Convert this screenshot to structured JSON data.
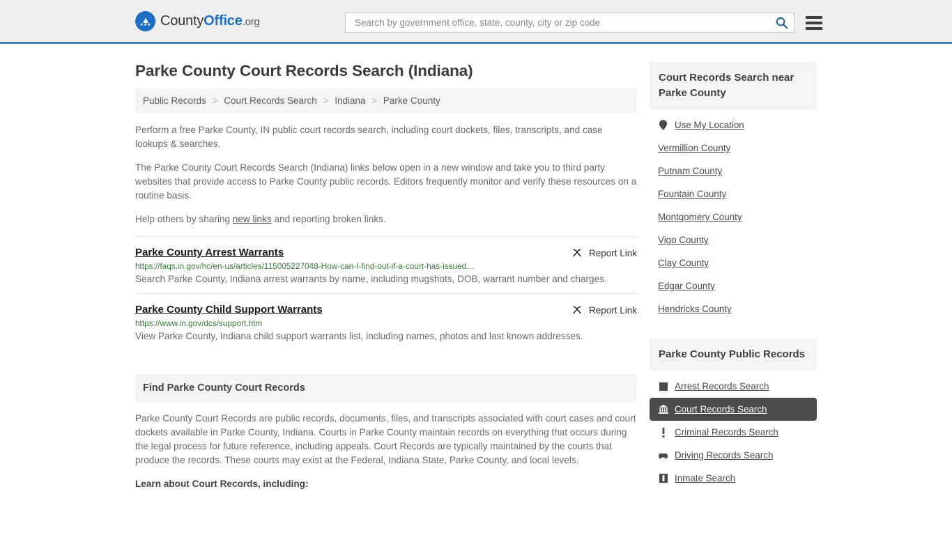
{
  "header": {
    "logo": {
      "word1": "County",
      "word2": "Office",
      "tld": ".org"
    },
    "search": {
      "placeholder": "Search by government office, state, county, city or zip code",
      "value": "",
      "search_icon": "search-icon",
      "menu_icon": "hamburger-menu-icon"
    }
  },
  "main": {
    "title": "Parke County Court Records Search (Indiana)",
    "breadcrumb": [
      "Public Records",
      "Court Records Search",
      "Indiana",
      "Parke County"
    ],
    "breadcrumb_separator": ">",
    "intro_paragraphs": [
      "Perform a free Parke County, IN public court records search, including court dockets, files, transcripts, and case lookups & searches.",
      "The Parke County Court Records Search (Indiana) links below open in a new window and take you to third party websites that provide access to Parke County public records. Editors frequently monitor and verify these resources on a routine basis."
    ],
    "help_line": {
      "before": "Help others by sharing ",
      "link": "new links",
      "after": " and reporting broken links."
    },
    "report_link_label": "Report Link",
    "results": [
      {
        "title": "Parke County Arrest Warrants",
        "url": "https://faqs.in.gov/hc/en-us/articles/115005227048-How-can-I-find-out-if-a-court-has-issued…",
        "description": "Search Parke County, Indiana arrest warrants by name, including mugshots, DOB, warrant number and charges."
      },
      {
        "title": "Parke County Child Support Warrants",
        "url": "https://www.in.gov/dcs/support.htm",
        "description": "View Parke County, Indiana child support warrants list, including names, photos and last known addresses."
      }
    ],
    "section": {
      "heading": "Find Parke County Court Records",
      "body": "Parke County Court Records are public records, documents, files, and transcripts associated with court cases and court dockets available in Parke County, Indiana. Courts in Parke County maintain records on everything that occurs during the legal process for future reference, including appeals. Court Records are typically maintained by the courts that produce the records. These courts may exist at the Federal, Indiana State, Parke County, and local levels.",
      "lead": "Learn about Court Records, including:"
    }
  },
  "sidebar": {
    "nearby": {
      "heading": "Court Records Search near Parke County",
      "use_my_location": {
        "label": "Use My Location",
        "icon": "map-pin-icon"
      },
      "counties": [
        "Vermillion County",
        "Putnam County",
        "Fountain County",
        "Montgomery County",
        "Vigo County",
        "Clay County",
        "Edgar County",
        "Hendricks County"
      ]
    },
    "public_records": {
      "heading": "Parke County Public Records",
      "items": [
        {
          "label": "Arrest Records Search",
          "icon": "square-badge-icon",
          "active": false
        },
        {
          "label": "Court Records Search",
          "icon": "courthouse-icon",
          "active": true
        },
        {
          "label": "Criminal Records Search",
          "icon": "exclamation-icon",
          "active": false
        },
        {
          "label": "Driving Records Search",
          "icon": "car-icon",
          "active": false
        },
        {
          "label": "Inmate Search",
          "icon": "inmate-icon",
          "active": false
        }
      ]
    }
  },
  "colors": {
    "brand_blue": "#1f6fc4",
    "header_border": "#3d7ab0",
    "panel_gray": "#f4f4f4",
    "active_dark": "#4a4a4a",
    "url_green": "#3a7a3a"
  }
}
